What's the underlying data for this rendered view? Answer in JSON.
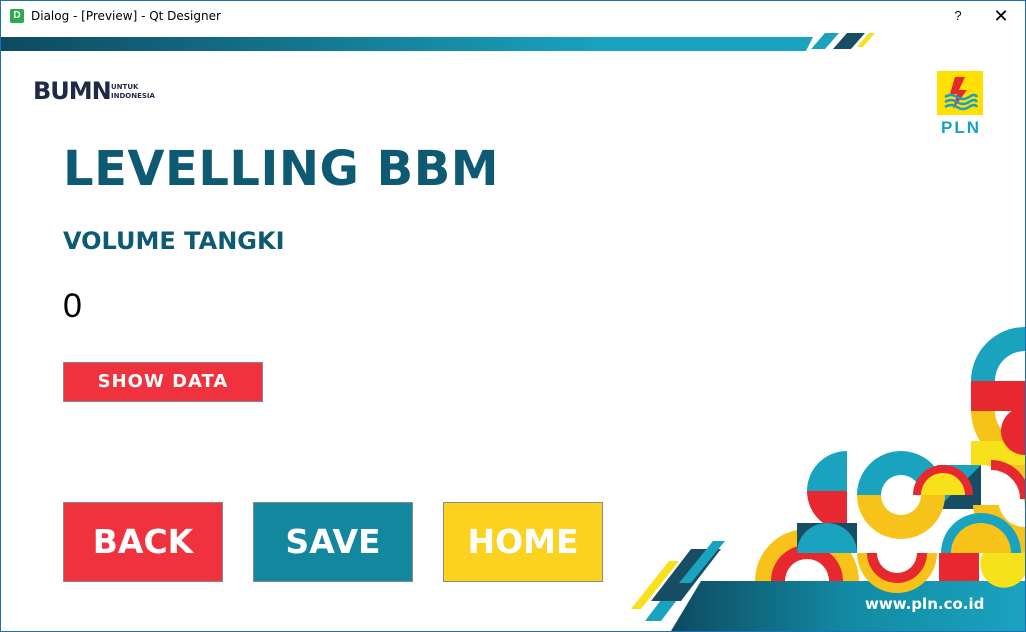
{
  "window": {
    "title": "Dialog - [Preview] - Qt Designer",
    "app_icon_letter": "D",
    "help_label": "?",
    "close_label": "✕"
  },
  "logos": {
    "bumn_mark": "BUMN",
    "bumn_tagline_1": "UNTUK",
    "bumn_tagline_2": "INDONESIA",
    "pln_text": "PLN"
  },
  "main": {
    "title": "LEVELLING BBM",
    "subtitle": "VOLUME TANGKI",
    "volume_value": "0"
  },
  "buttons": {
    "show_data": "SHOW DATA",
    "back": "BACK",
    "save": "SAVE",
    "home": "HOME"
  },
  "footer": {
    "website": "www.pln.co.id"
  },
  "colors": {
    "primary_teal": "#0e5a73",
    "accent_red": "#f0313e",
    "accent_teal": "#13879e",
    "accent_yellow": "#fbd21e"
  }
}
